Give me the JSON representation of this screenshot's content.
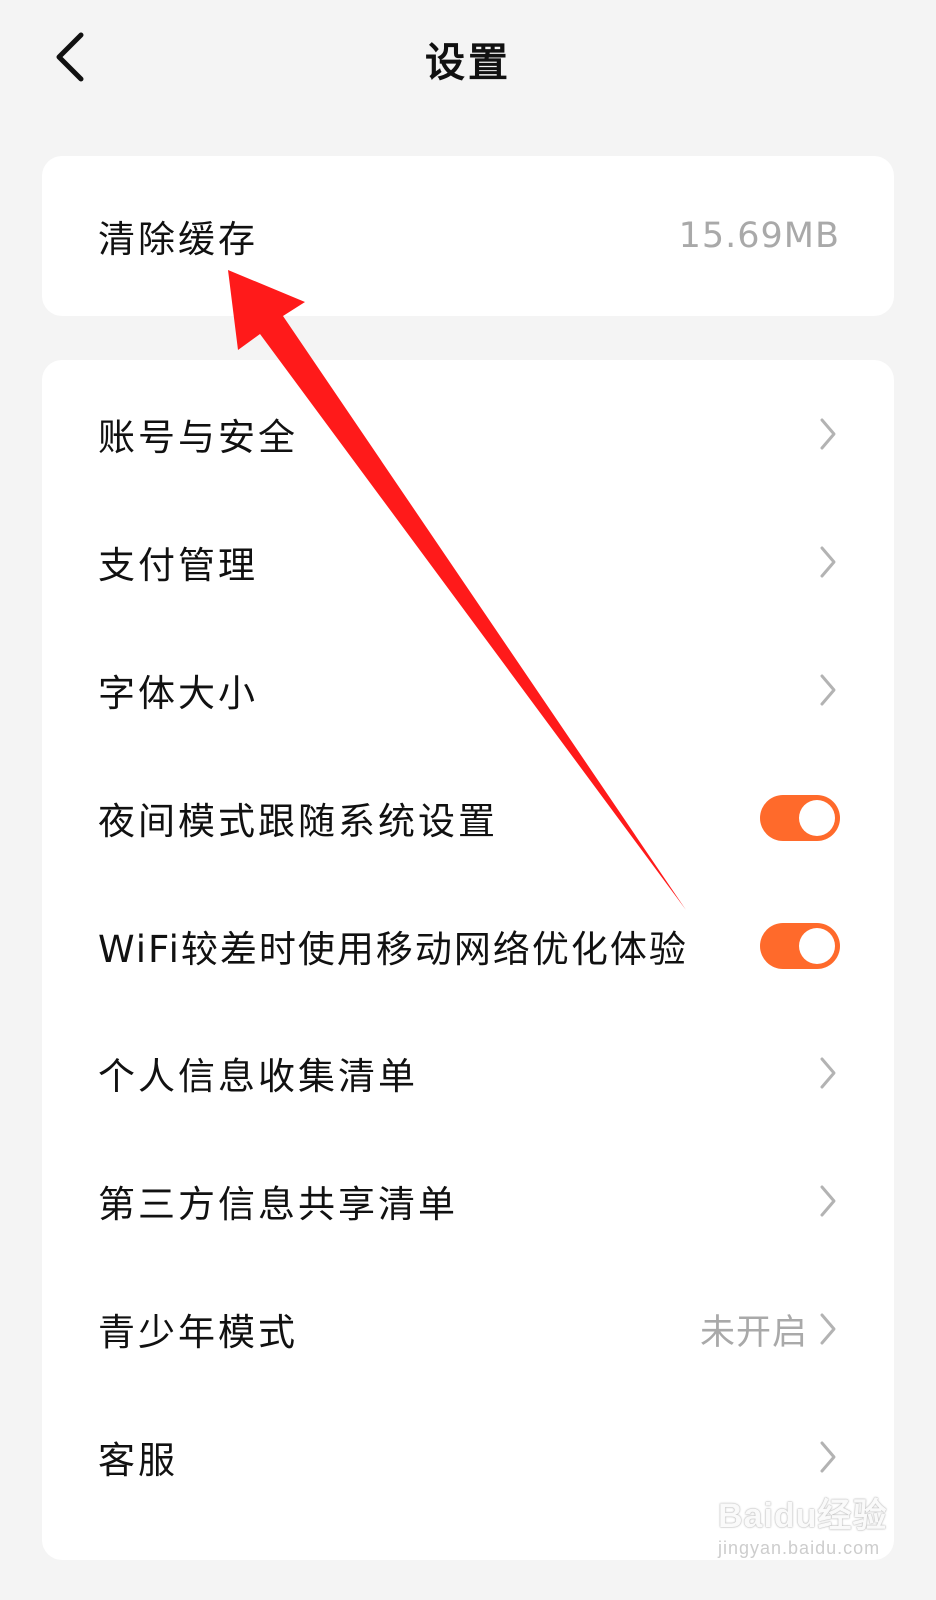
{
  "header": {
    "title": "设置"
  },
  "cache": {
    "label": "清除缓存",
    "size": "15.69MB"
  },
  "settings": {
    "account_security": "账号与安全",
    "payment": "支付管理",
    "font_size": "字体大小",
    "night_mode": {
      "label": "夜间模式跟随系统设置",
      "on": true
    },
    "wifi_optimize": {
      "label": "WiFi较差时使用移动网络优化体验",
      "on": true
    },
    "personal_info": "个人信息收集清单",
    "third_party": "第三方信息共享清单",
    "teen_mode": {
      "label": "青少年模式",
      "status": "未开启"
    },
    "customer_service": "客服"
  },
  "colors": {
    "toggle_on": "#ff6a2b",
    "annotation_arrow": "#ff1a1a"
  },
  "icons": [
    "back-arrow-icon",
    "chevron-right-icon"
  ],
  "watermark": {
    "main": "Baidu经验",
    "sub": "jingyan.baidu.com"
  }
}
